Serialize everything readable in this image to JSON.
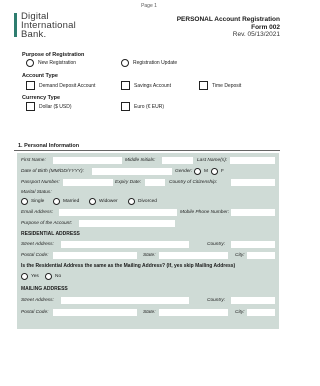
{
  "page_label": "Page 1",
  "logo": {
    "line1": "Digital",
    "line2": "International",
    "line3": "Bank."
  },
  "form": {
    "title": "PERSONAL Account  Registration",
    "number": "Form 002",
    "revision": "Rev.  05/13/2021"
  },
  "purpose": {
    "label": "Purpose of Registration",
    "options": [
      "New Registration",
      "Registration Update"
    ]
  },
  "account_type": {
    "label": "Account Type",
    "options": [
      "Demand Deposit Account",
      "Savings Account",
      "Time Deposit"
    ]
  },
  "currency_type": {
    "label": "Currency Type",
    "options": [
      "Dollar ($ USD)",
      "Euro (€ EUR)"
    ]
  },
  "personal_info": {
    "title": "1. Personal Information",
    "first_name": "First Name:",
    "middle_initials": "Middle Initials:",
    "last_names": "Last Name(s):",
    "dob": "Date of Birth (MM/DD/YYYY):",
    "gender": "Gender:",
    "gender_options": [
      "M",
      "F"
    ],
    "passport": "Passport Number:",
    "expiry": "Expiry Date:",
    "citizenship": "Country of Citizenship:",
    "marital": "Marital Status:",
    "marital_options": [
      "Single",
      "Married",
      "Widower",
      "Divorced"
    ],
    "email": "Email Address:",
    "mobile": "Mobile Phone Number:",
    "purpose_account": "Purpose of the Account:"
  },
  "residential": {
    "title": "RESIDENTIAL ADDRESS",
    "street": "Street Address:",
    "country": "Country:",
    "postal": "Postal Code:",
    "state": "State:",
    "city": "City:"
  },
  "same_question": {
    "text": "Is the Residential Address the same as the Mailing Address? (If, yes skip Mailing Address)",
    "options": [
      "Yes",
      "No"
    ]
  },
  "mailing": {
    "title": "MAILING ADDRESS",
    "street": "Street Address:",
    "country": "Country:",
    "postal": "Postal Code:",
    "state": "State:",
    "city": "City:"
  }
}
